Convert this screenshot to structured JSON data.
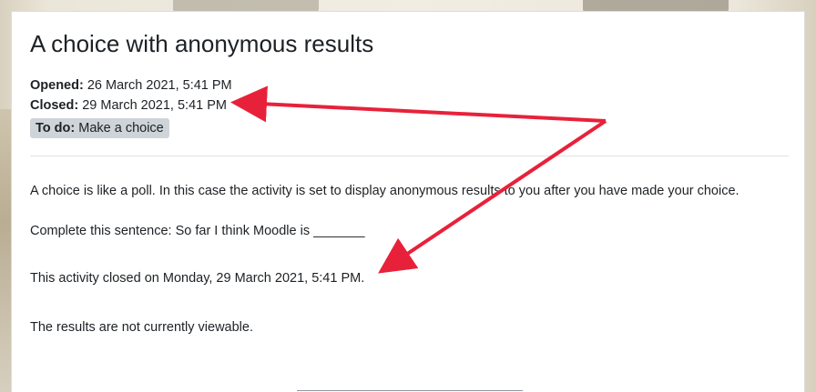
{
  "activity": {
    "title": "A choice with anonymous results"
  },
  "dates": {
    "opened_label": "Opened:",
    "opened_value": "26 March 2021, 5:41 PM",
    "closed_label": "Closed:",
    "closed_value": "29 March 2021, 5:41 PM"
  },
  "todo": {
    "label": "To do:",
    "value": "Make a choice"
  },
  "content": {
    "intro": "A choice is like a poll. In this case the activity is set to display anonymous results to you after you have made your choice.",
    "sentence": "Complete this sentence: So far I think Moodle is _______",
    "closed_notice": "This activity closed on Monday, 29 March 2021, 5:41 PM.",
    "results_notice": "The results are not currently viewable."
  },
  "colors": {
    "arrow": "#e8213a",
    "badge": "#ced4da",
    "text": "#1d2125"
  }
}
